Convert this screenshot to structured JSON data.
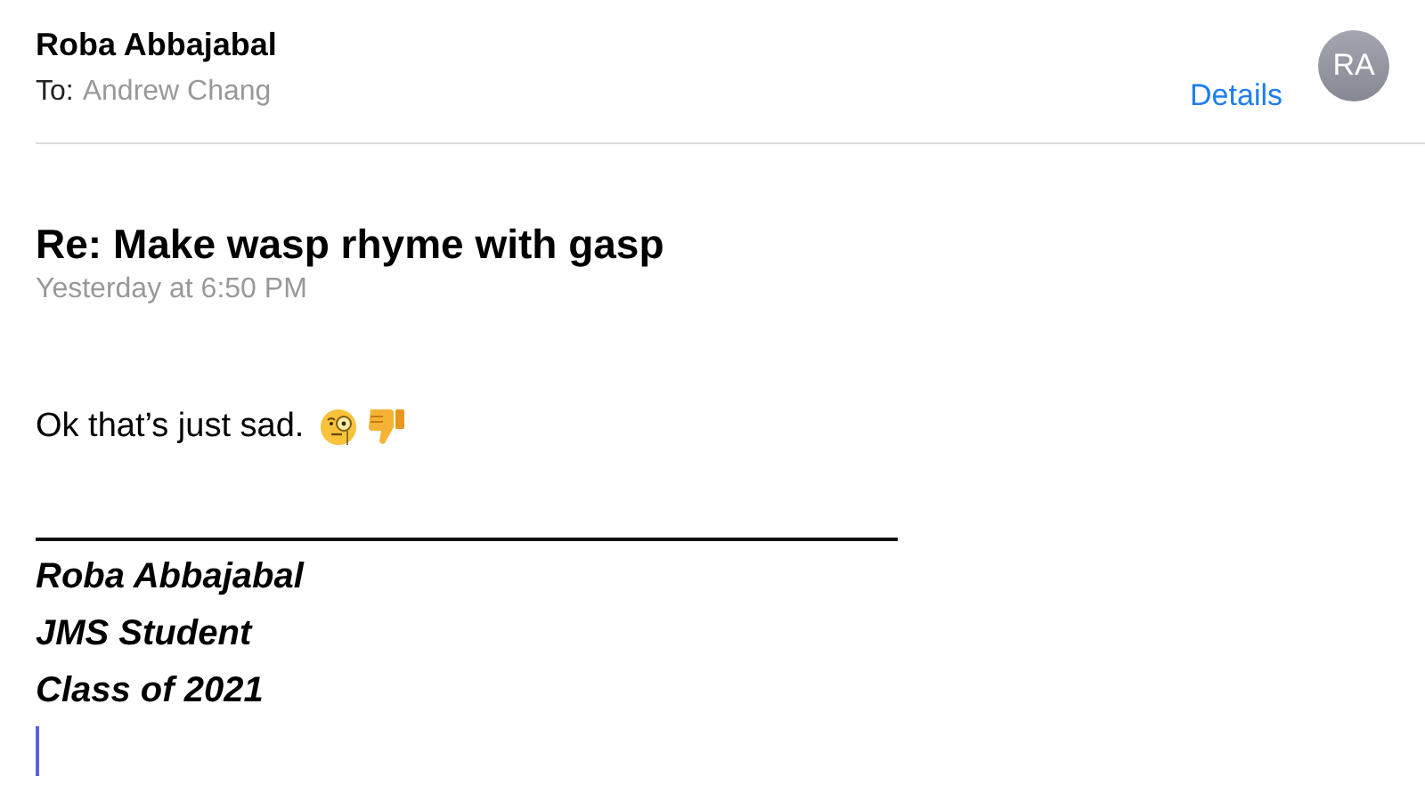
{
  "header": {
    "sender": "Roba Abbajabal",
    "to_label": "To:",
    "recipient": "Andrew Chang",
    "details_link": "Details",
    "avatar_initials": "RA"
  },
  "message": {
    "subject": "Re: Make wasp rhyme with gasp",
    "date": "Yesterday at 6:50 PM",
    "body": "Ok that’s just sad.",
    "signature": [
      "Roba Abbajabal",
      "JMS Student",
      "Class of 2021"
    ]
  }
}
